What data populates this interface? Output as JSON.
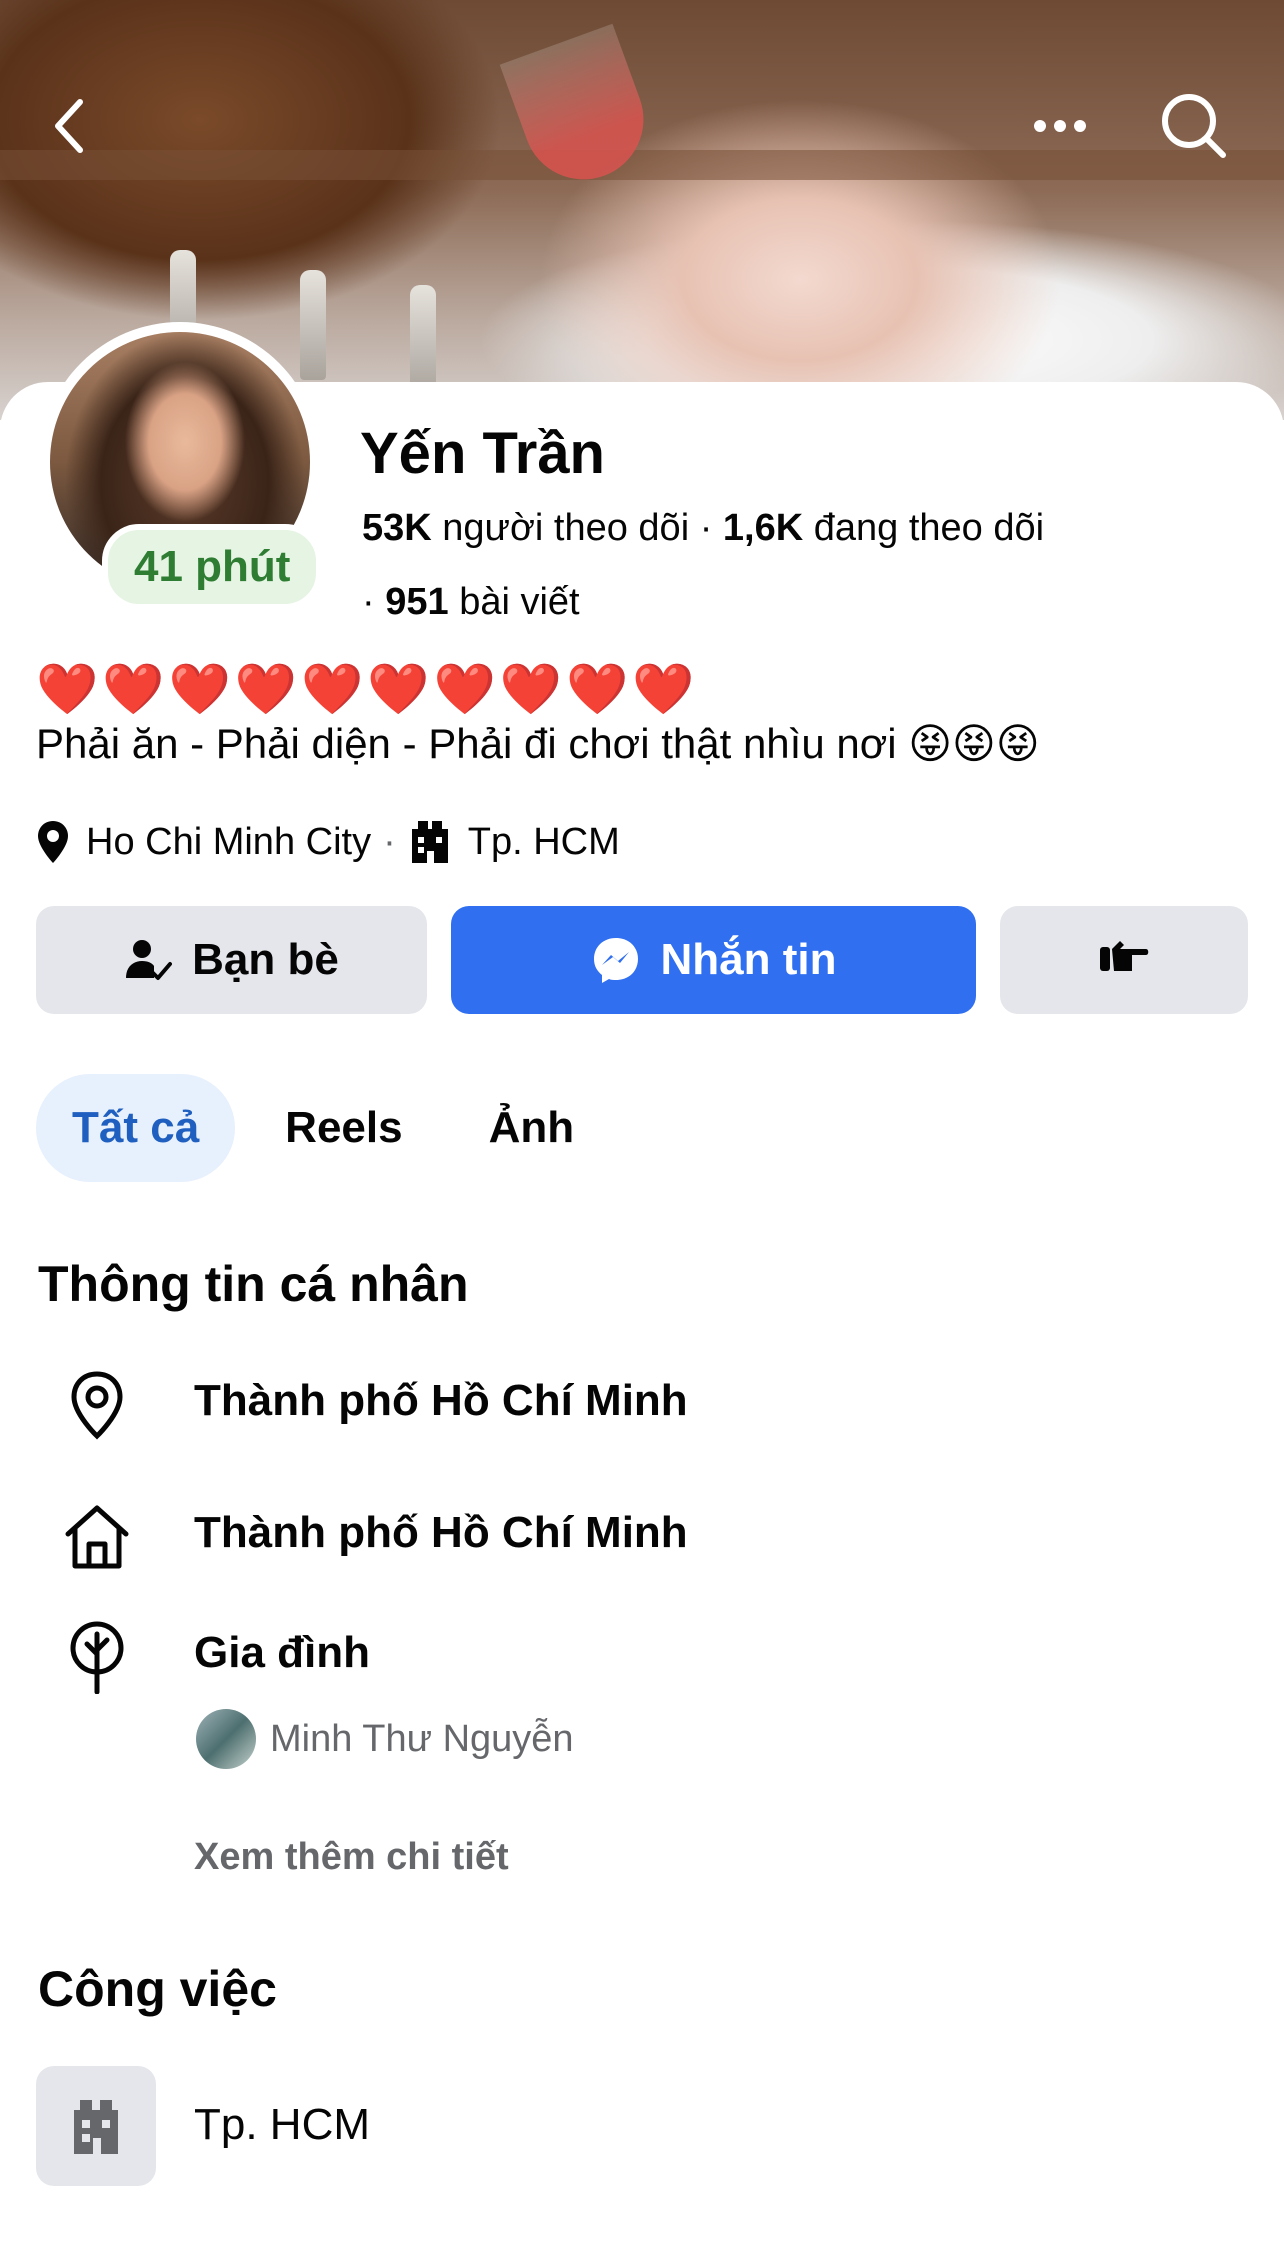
{
  "profile": {
    "name": "Yến Trần",
    "status": "41 phút",
    "followers_count": "53K",
    "followers_label": "người theo dõi",
    "following_count": "1,6K",
    "following_label": "đang theo dõi",
    "posts_count": "951",
    "posts_label": "bài viết",
    "hearts": "❤️❤️❤️❤️❤️❤️❤️❤️❤️❤️",
    "bio": "Phải ăn - Phải diện - Phải đi  chơi thật nhìu nơi 😝😝😝",
    "location": "Ho Chi Minh City",
    "workplace": "Tp. HCM"
  },
  "actions": {
    "friends_label": "Bạn bè",
    "message_label": "Nhắn tin"
  },
  "tabs": [
    {
      "label": "Tất cả",
      "active": true
    },
    {
      "label": "Reels",
      "active": false
    },
    {
      "label": "Ảnh",
      "active": false
    }
  ],
  "about": {
    "title": "Thông tin cá nhân",
    "current_city": "Thành phố Hồ Chí Minh",
    "hometown": "Thành phố Hồ Chí Minh",
    "family_label": "Gia đình",
    "family_member": "Minh Thư Nguyễn",
    "see_more": "Xem thêm chi tiết"
  },
  "work": {
    "title": "Công việc",
    "place": "Tp. HCM"
  },
  "icons": {
    "back": "chevron-left-icon",
    "more": "ellipsis-icon",
    "search": "search-icon",
    "location": "map-pin-icon",
    "building": "building-icon",
    "friends": "friend-check-icon",
    "messenger": "messenger-icon",
    "poke": "poke-hand-icon",
    "home": "home-icon",
    "family": "family-tree-icon"
  },
  "colors": {
    "primary": "#2f6ff0",
    "active_tab_bg": "#e7f0fd",
    "active_tab_text": "#1f5fbf",
    "status_green": "#2e7d32",
    "button_gray": "#e4e6eb"
  }
}
